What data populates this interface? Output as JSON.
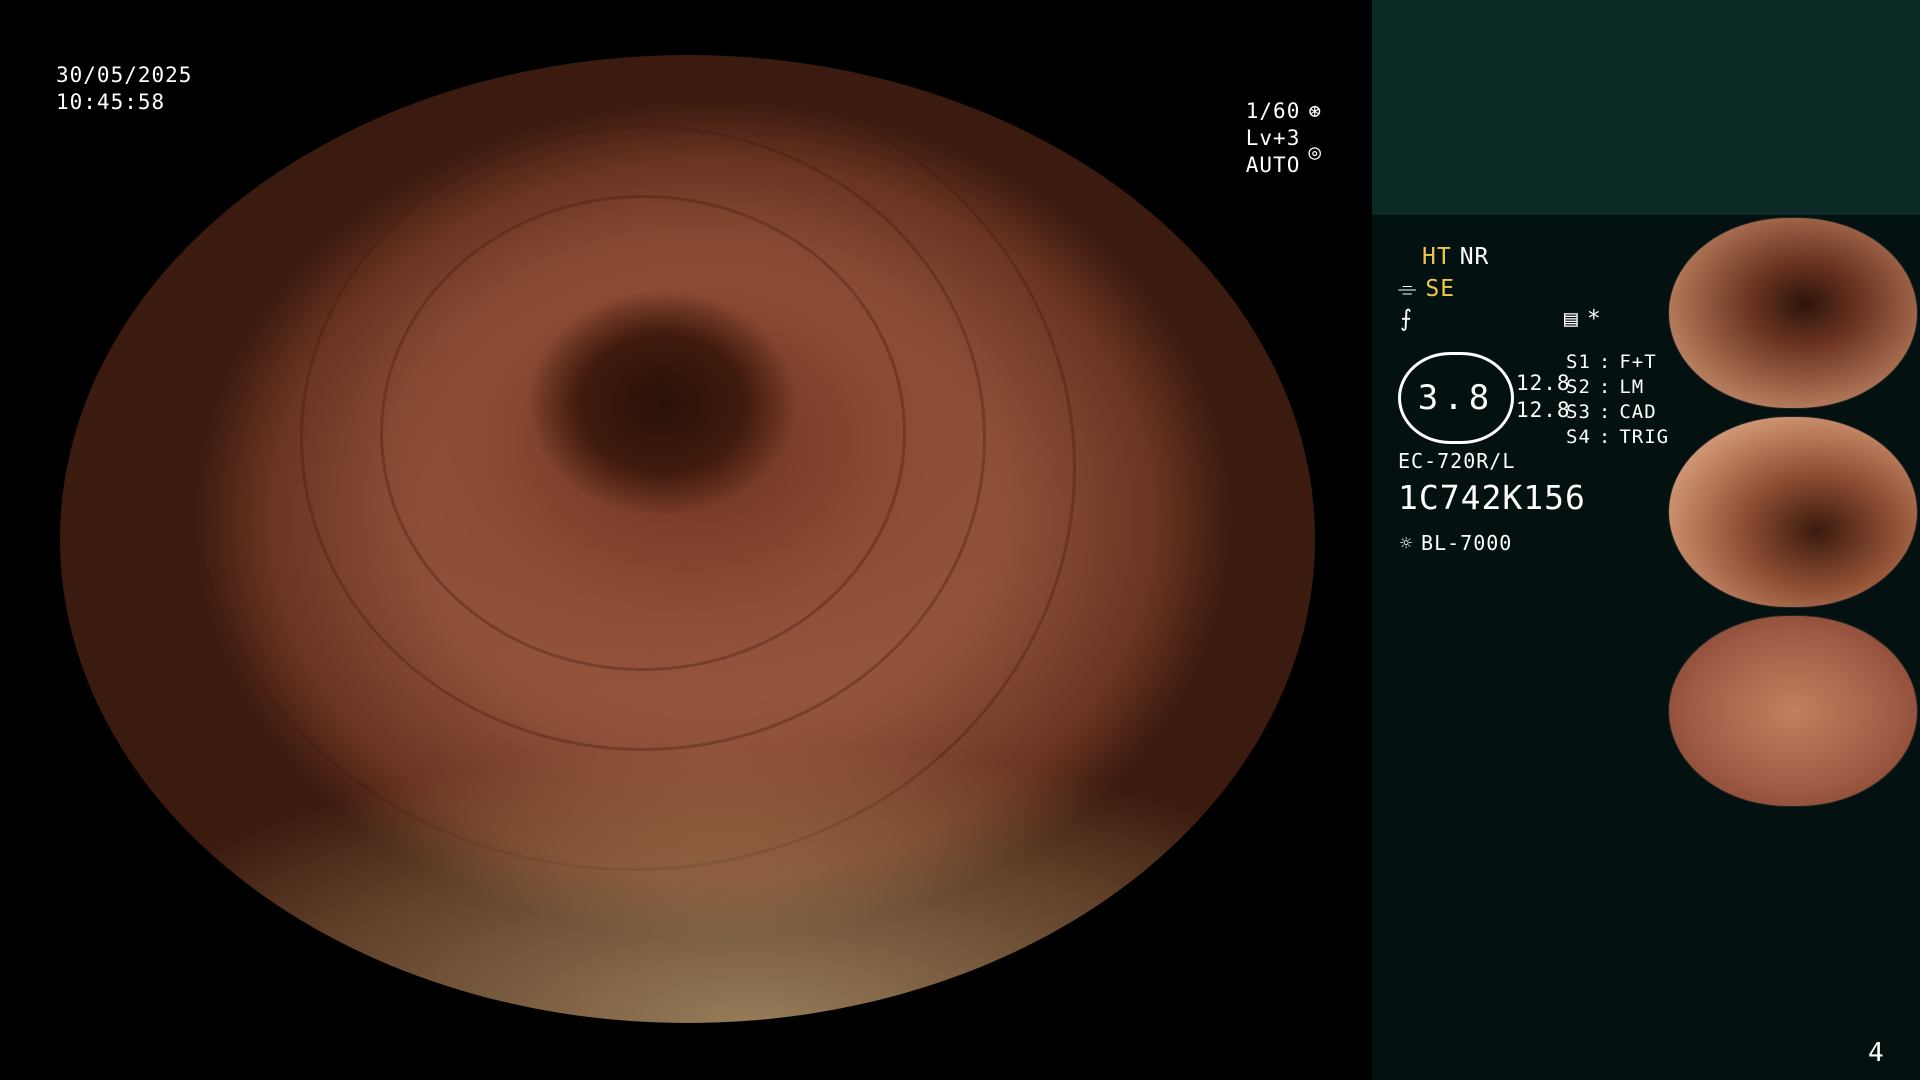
{
  "overlay": {
    "date": "30/05/2025",
    "time": "10:45:58",
    "shutter": "1/60",
    "exposure": "Lv+3 AUTO"
  },
  "settings": {
    "ht": "HT",
    "nr": "NR",
    "se": "SE",
    "asterisk": "*",
    "zoom_value": "3.8",
    "zoom_right_top": "12.8",
    "zoom_right_bottom": "12.8",
    "switches": [
      {
        "key": "S1",
        "value": "F+T"
      },
      {
        "key": "S2",
        "value": "LM"
      },
      {
        "key": "S3",
        "value": "CAD"
      },
      {
        "key": "S4",
        "value": "TRIG"
      }
    ],
    "scope_model": "EC-720R/L",
    "serial": "1C742K156",
    "light_source": "BL-7000"
  },
  "page_number": "4",
  "colors": {
    "accent_yellow": "#f0c64b",
    "panel_bg": "#031210",
    "panel_top": "#0b2925"
  },
  "icons": [
    "aperture-icon",
    "iris-icon",
    "structure-enhance-icon",
    "color-icon",
    "menu-icon",
    "lamp-icon"
  ]
}
